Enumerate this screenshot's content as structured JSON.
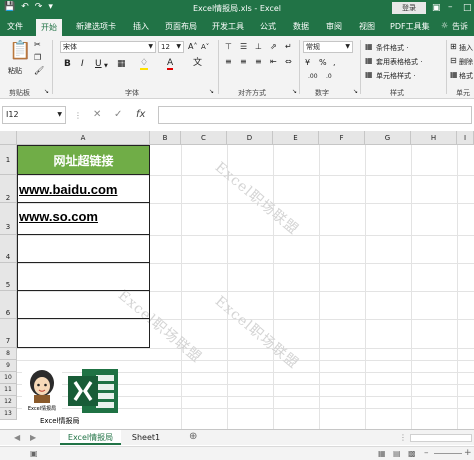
{
  "window": {
    "title": "Excel情报局.xls - Excel",
    "login_label": "登录"
  },
  "ribbon_tabs": [
    "文件",
    "开始",
    "新建选项卡",
    "插入",
    "页面布局",
    "开发工具",
    "公式",
    "数据",
    "审阅",
    "视图",
    "PDF工具集",
    "告诉"
  ],
  "ribbon": {
    "paste_label": "粘贴",
    "font_name": "宋体",
    "font_size": "12",
    "number_format": "常规",
    "conditional_format_label": "条件格式 ·",
    "table_format_label": "套用表格格式 ·",
    "cell_style_label": "单元格样式 ·",
    "insert_label": "插入",
    "delete_label": "删除",
    "format_label": "格式",
    "groups": {
      "clipboard": "剪贴板",
      "font": "字体",
      "alignment": "对齐方式",
      "number": "数字",
      "styles": "样式",
      "cells": "单元"
    }
  },
  "formula_bar": {
    "name_box": "I12",
    "fx_label": "fx",
    "formula": ""
  },
  "grid": {
    "columns": [
      "A",
      "B",
      "C",
      "D",
      "E",
      "F",
      "G",
      "H",
      "I"
    ],
    "rows": [
      "1",
      "2",
      "3",
      "4",
      "5",
      "6",
      "7",
      "8",
      "9",
      "10",
      "11",
      "12",
      "13"
    ],
    "header_cell": "网址超链接",
    "cells": [
      "www.baidu.com",
      "www.so.com",
      "",
      "",
      "",
      ""
    ],
    "logo_caption_small": "Excel情报局",
    "logo_caption": "Excel情报局",
    "watermark": "Excel职场联盟"
  },
  "sheets": {
    "active": "Excel情报局",
    "other": "Sheet1"
  },
  "colors": {
    "accent": "#217346",
    "header_fill": "#70ad47"
  }
}
